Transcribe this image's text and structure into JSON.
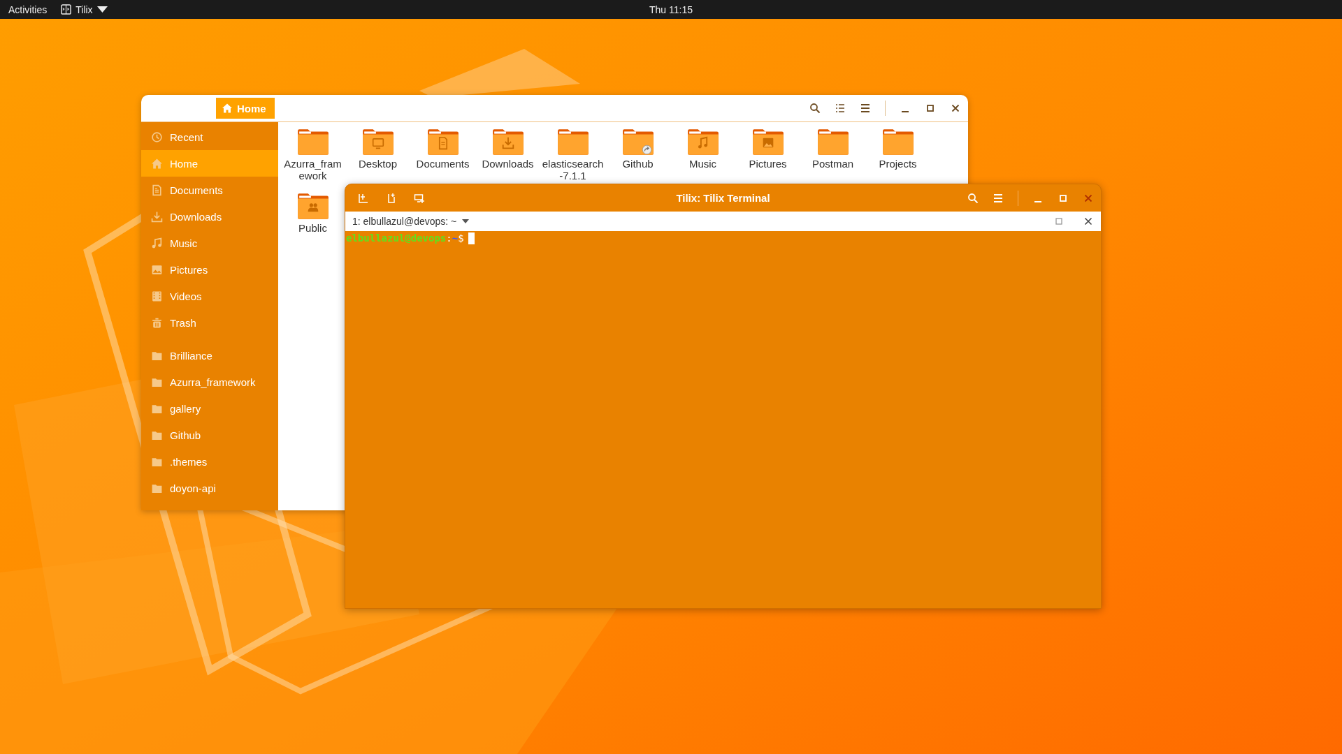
{
  "top_bar": {
    "activities": "Activities",
    "app_menu": "Tilix",
    "clock": "Thu 11:15"
  },
  "files_window": {
    "location": "Home",
    "places": [
      {
        "label": "Recent",
        "kind": "recent",
        "selected": false
      },
      {
        "label": "Home",
        "kind": "home",
        "selected": true
      },
      {
        "label": "Documents",
        "kind": "documents",
        "selected": false
      },
      {
        "label": "Downloads",
        "kind": "downloads",
        "selected": false
      },
      {
        "label": "Music",
        "kind": "music",
        "selected": false
      },
      {
        "label": "Pictures",
        "kind": "pictures",
        "selected": false
      },
      {
        "label": "Videos",
        "kind": "videos",
        "selected": false
      },
      {
        "label": "Trash",
        "kind": "trash",
        "selected": false
      }
    ],
    "bookmarks": [
      {
        "label": "Brilliance",
        "selected": false
      },
      {
        "label": "Azurra_framework",
        "selected": false
      },
      {
        "label": "gallery",
        "selected": false
      },
      {
        "label": "Github",
        "selected": false
      },
      {
        "label": ".themes",
        "selected": false
      },
      {
        "label": "doyon-api",
        "selected": false
      }
    ],
    "folders": [
      {
        "name": "Azurra_framework",
        "kind": "plain"
      },
      {
        "name": "Desktop",
        "kind": "desktop"
      },
      {
        "name": "Documents",
        "kind": "documents"
      },
      {
        "name": "Downloads",
        "kind": "downloads"
      },
      {
        "name": "elasticsearch-7.1.1",
        "kind": "plain"
      },
      {
        "name": "Github",
        "kind": "link"
      },
      {
        "name": "Music",
        "kind": "music"
      },
      {
        "name": "Pictures",
        "kind": "pictures"
      },
      {
        "name": "Postman",
        "kind": "plain"
      },
      {
        "name": "Projects",
        "kind": "plain"
      },
      {
        "name": "Public",
        "kind": "public"
      }
    ]
  },
  "terminal": {
    "title": "Tilix: Tilix Terminal",
    "tab": "1: elbullazul@devops: ~",
    "prompt": {
      "user_host": "elbullazul@devops",
      "separator": ":",
      "path": "~",
      "symbol": "$"
    }
  }
}
